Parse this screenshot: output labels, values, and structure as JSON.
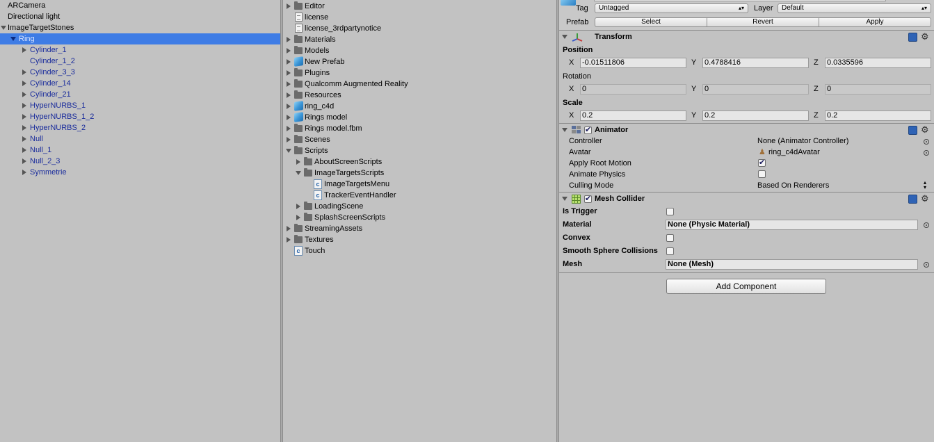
{
  "hierarchy": {
    "items": [
      {
        "label": "ARCamera"
      },
      {
        "label": "Directional light"
      },
      {
        "label": "ImageTargetStones"
      },
      {
        "label": "Ring"
      },
      {
        "label": "Cylinder_1"
      },
      {
        "label": "Cylinder_1_2"
      },
      {
        "label": "Cylinder_3_3"
      },
      {
        "label": "Cylinder_14"
      },
      {
        "label": "Cylinder_21"
      },
      {
        "label": "HyperNURBS_1"
      },
      {
        "label": "HyperNURBS_1_2"
      },
      {
        "label": "HyperNURBS_2"
      },
      {
        "label": "Null"
      },
      {
        "label": "Null_1"
      },
      {
        "label": "Null_2_3"
      },
      {
        "label": "Symmetrie"
      }
    ]
  },
  "project": {
    "items": [
      {
        "label": "Editor",
        "icon": "folder-icon"
      },
      {
        "label": "license",
        "icon": "text-file-icon"
      },
      {
        "label": "license_3rdpartynotice",
        "icon": "text-file-icon"
      },
      {
        "label": "Materials",
        "icon": "folder-icon"
      },
      {
        "label": "Models",
        "icon": "folder-icon"
      },
      {
        "label": "New Prefab",
        "icon": "prefab-icon"
      },
      {
        "label": "Plugins",
        "icon": "folder-icon"
      },
      {
        "label": "Qualcomm Augmented Reality",
        "icon": "folder-icon"
      },
      {
        "label": "Resources",
        "icon": "folder-icon"
      },
      {
        "label": "ring_c4d",
        "icon": "prefab-icon"
      },
      {
        "label": "Rings model",
        "icon": "prefab-icon"
      },
      {
        "label": "Rings model.fbm",
        "icon": "folder-icon"
      },
      {
        "label": "Scenes",
        "icon": "folder-icon"
      },
      {
        "label": "Scripts",
        "icon": "folder-icon"
      },
      {
        "label": "AboutScreenScripts",
        "icon": "folder-icon"
      },
      {
        "label": "ImageTargetsScripts",
        "icon": "folder-icon"
      },
      {
        "label": "ImageTargetsMenu",
        "icon": "csharp-script-icon"
      },
      {
        "label": "TrackerEventHandler",
        "icon": "csharp-script-icon"
      },
      {
        "label": "LoadingScene",
        "icon": "folder-icon"
      },
      {
        "label": "SplashScreenScripts",
        "icon": "folder-icon"
      },
      {
        "label": "StreamingAssets",
        "icon": "folder-icon"
      },
      {
        "label": "Textures",
        "icon": "folder-icon"
      },
      {
        "label": "Touch",
        "icon": "csharp-script-icon"
      }
    ]
  },
  "inspector": {
    "tag_label": "Tag",
    "tag_value": "Untagged",
    "layer_label": "Layer",
    "layer_value": "Default",
    "prefab_label": "Prefab",
    "prefab_select": "Select",
    "prefab_revert": "Revert",
    "prefab_apply": "Apply",
    "transform": {
      "title": "Transform",
      "position_label": "Position",
      "rotation_label": "Rotation",
      "scale_label": "Scale",
      "axis_x": "X",
      "axis_y": "Y",
      "axis_z": "Z",
      "position": {
        "x": "-0.01511806",
        "y": "0.4788416",
        "z": "0.0335596"
      },
      "rotation": {
        "x": "0",
        "y": "0",
        "z": "0"
      },
      "scale": {
        "x": "0.2",
        "y": "0.2",
        "z": "0.2"
      }
    },
    "animator": {
      "title": "Animator",
      "enabled": true,
      "controller_label": "Controller",
      "controller_value": "None (Animator Controller)",
      "avatar_label": "Avatar",
      "avatar_value": "ring_c4dAvatar",
      "apply_root_motion_label": "Apply Root Motion",
      "apply_root_motion": true,
      "animate_physics_label": "Animate Physics",
      "animate_physics": false,
      "culling_mode_label": "Culling Mode",
      "culling_mode_value": "Based On Renderers"
    },
    "mesh_collider": {
      "title": "Mesh Collider",
      "enabled": true,
      "is_trigger_label": "Is Trigger",
      "is_trigger": false,
      "material_label": "Material",
      "material_value": "None (Physic Material)",
      "convex_label": "Convex",
      "convex": false,
      "smooth_label": "Smooth Sphere Collisions",
      "smooth": false,
      "mesh_label": "Mesh",
      "mesh_value": "None (Mesh)"
    },
    "add_component": "Add Component"
  }
}
